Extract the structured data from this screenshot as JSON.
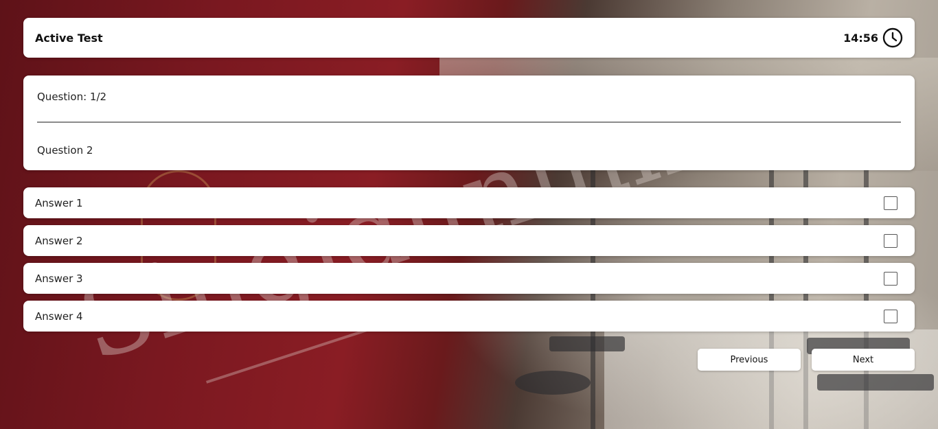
{
  "header": {
    "title": "Active Test",
    "timer": "14:56",
    "timer_icon": "clock-icon"
  },
  "question": {
    "number_label": "Question: 1/2",
    "text": "Question 2"
  },
  "answers": [
    {
      "label": "Answer 1",
      "checked": false
    },
    {
      "label": "Answer 2",
      "checked": false
    },
    {
      "label": "Answer 3",
      "checked": false
    },
    {
      "label": "Answer 4",
      "checked": false
    }
  ],
  "nav": {
    "previous_label": "Previous",
    "next_label": "Next"
  },
  "background": {
    "watermark_text": "Singidunum"
  },
  "colors": {
    "card": "#ffffff",
    "text": "#111111",
    "divider": "#8a8a8a",
    "background_accent": "#7a1820"
  }
}
